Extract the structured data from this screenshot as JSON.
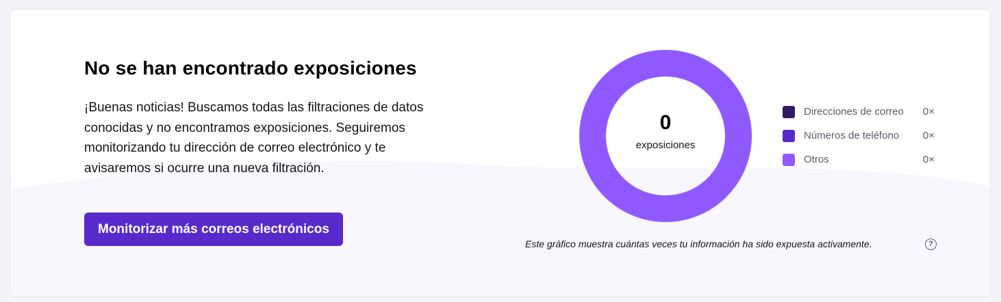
{
  "header": {
    "title": "No se han encontrado exposiciones"
  },
  "body": {
    "description": "¡Buenas noticias! Buscamos todas las filtraciones de datos conocidas y no encontramos exposiciones. Seguiremos monitorizando tu dirección de correo electrónico y te avisaremos si ocurre una nueva filtración."
  },
  "cta": {
    "label": "Monitorizar más correos electrónicos"
  },
  "chart": {
    "center_count": "0",
    "center_label": "exposiciones",
    "caption": "Este gráfico muestra cuántas veces tu información ha sido expuesta activamente.",
    "help_icon": "question-circle-icon",
    "ring_color": "#9059ff",
    "legend": [
      {
        "label": "Direcciones de correo",
        "value": "0×",
        "color": "#321c64"
      },
      {
        "label": "Números de teléfono",
        "value": "0×",
        "color": "#592acb"
      },
      {
        "label": "Otros",
        "value": "0×",
        "color": "#9059ff"
      }
    ]
  },
  "colors": {
    "accent": "#592acb",
    "background_wave": "#f9f7fe"
  }
}
